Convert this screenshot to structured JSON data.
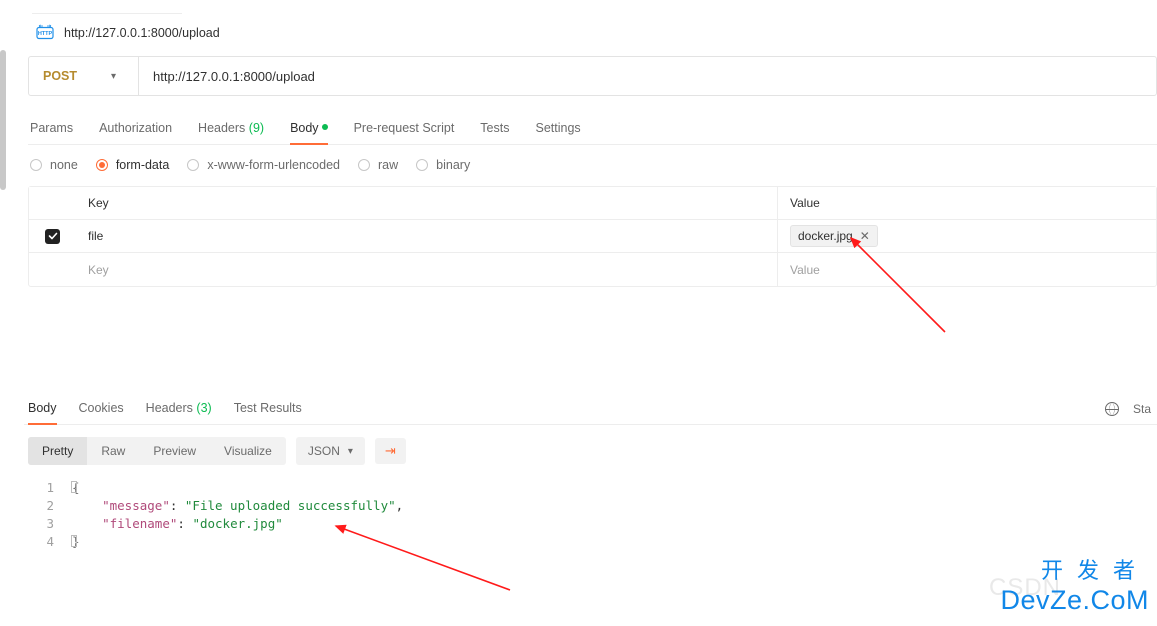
{
  "breadcrumb": {
    "url": "http://127.0.0.1:8000/upload"
  },
  "request": {
    "method": "POST",
    "url": "http://127.0.0.1:8000/upload",
    "tabs": {
      "params": "Params",
      "auth": "Authorization",
      "headers": "Headers",
      "headers_count": "(9)",
      "body": "Body",
      "prerequest": "Pre-request Script",
      "tests": "Tests",
      "settings": "Settings"
    },
    "body_types": {
      "none": "none",
      "formdata": "form-data",
      "urlencoded": "x-www-form-urlencoded",
      "raw": "raw",
      "binary": "binary"
    },
    "kv": {
      "key_header": "Key",
      "value_header": "Value",
      "rows": [
        {
          "enabled": true,
          "key": "file",
          "file_name": "docker.jpg"
        }
      ],
      "key_placeholder": "Key",
      "value_placeholder": "Value"
    }
  },
  "response": {
    "tabs": {
      "body": "Body",
      "cookies": "Cookies",
      "headers": "Headers",
      "headers_count": "(3)",
      "testresults": "Test Results"
    },
    "status_hint": "Sta",
    "viewer": {
      "pretty": "Pretty",
      "raw": "Raw",
      "preview": "Preview",
      "visualize": "Visualize",
      "format": "JSON"
    },
    "json": {
      "message_key": "\"message\"",
      "message_val": "\"File uploaded successfully\"",
      "filename_key": "\"filename\"",
      "filename_val": "\"docker.jpg\""
    }
  },
  "watermark": {
    "line1": "开发者",
    "line2": "DevZe.CoM",
    "csdn": "CSDN"
  }
}
